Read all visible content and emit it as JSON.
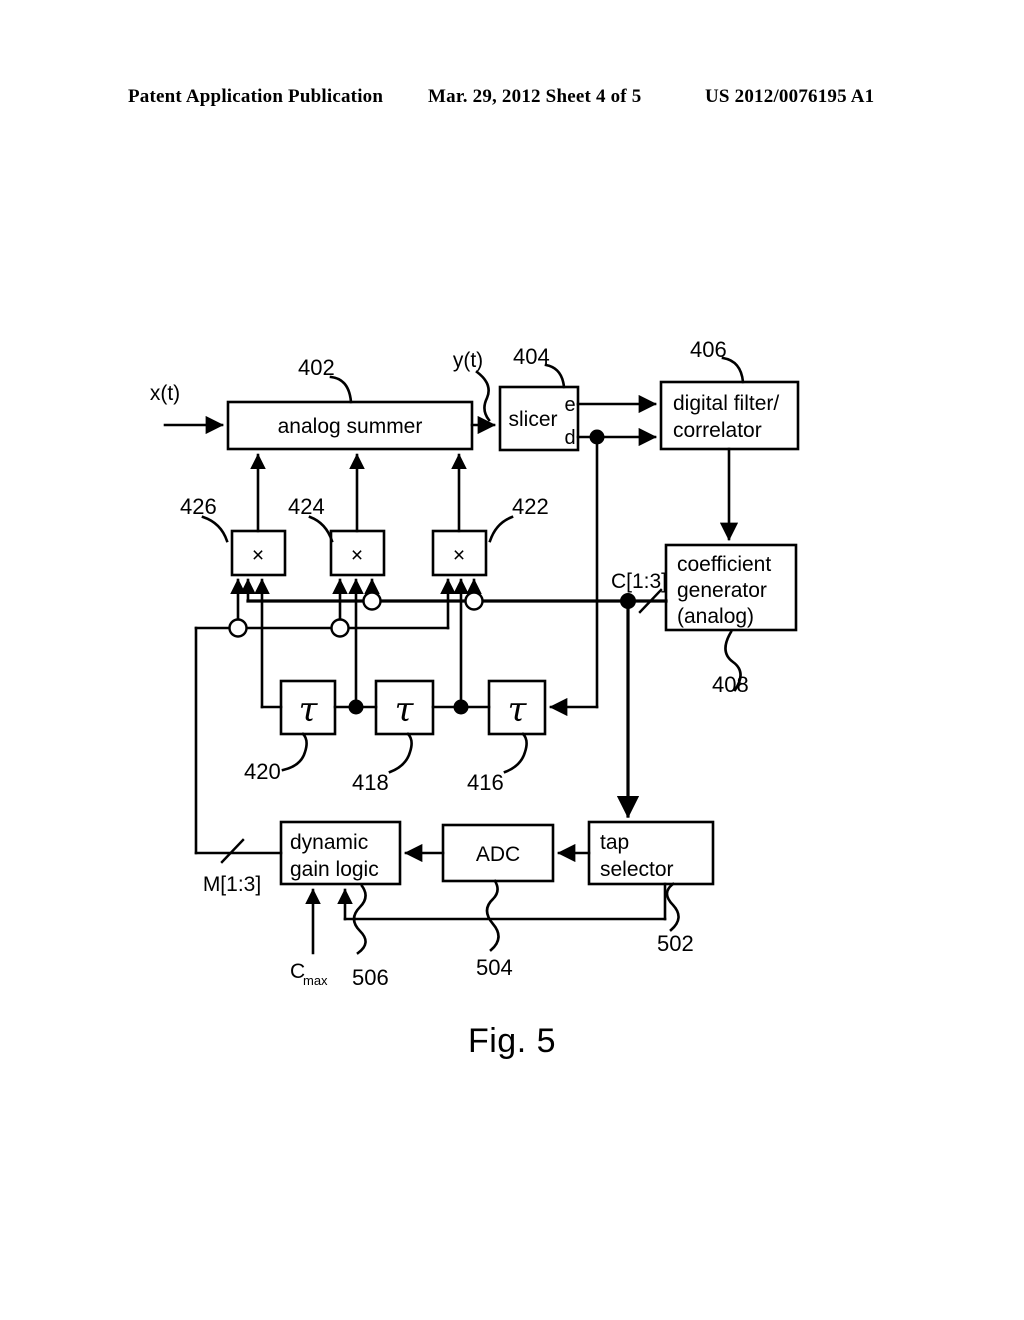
{
  "header": {
    "left": "Patent Application Publication",
    "middle": "Mar. 29, 2012  Sheet 4 of 5",
    "right": "US 2012/0076195 A1"
  },
  "figure": {
    "caption": "Fig. 5",
    "blocks": {
      "analog_summer": "analog summer",
      "slicer": "slicer",
      "digital_filter_line1": "digital filter/",
      "digital_filter_line2": "correlator",
      "coefficient_generator_line1": "coefficient",
      "coefficient_generator_line2": "generator",
      "coefficient_generator_line3": "(analog)",
      "tap_selector_line1": "tap",
      "tap_selector_line2": "selector",
      "adc": "ADC",
      "dynamic_gain_logic_line1": "dynamic",
      "dynamic_gain_logic_line2": "gain logic",
      "multiplier_symbol": "×",
      "delay_symbol": "τ"
    },
    "signals": {
      "input": "x(t)",
      "summer_output": "y(t)",
      "slicer_error_port": "e",
      "slicer_decision_port": "d",
      "coefficient_bus": "C[1:3]",
      "gain_bus": "M[1:3]",
      "cmax_base": "C",
      "cmax_sub": "max"
    },
    "reference_numerals": {
      "summer": "402",
      "slicer": "404",
      "digital_filter": "406",
      "coefficient_generator": "408",
      "delay_416": "416",
      "delay_418": "418",
      "delay_420": "420",
      "multiplier_422": "422",
      "multiplier_424": "424",
      "multiplier_426": "426",
      "tap_selector": "502",
      "adc": "504",
      "dynamic_gain_logic": "506"
    }
  }
}
